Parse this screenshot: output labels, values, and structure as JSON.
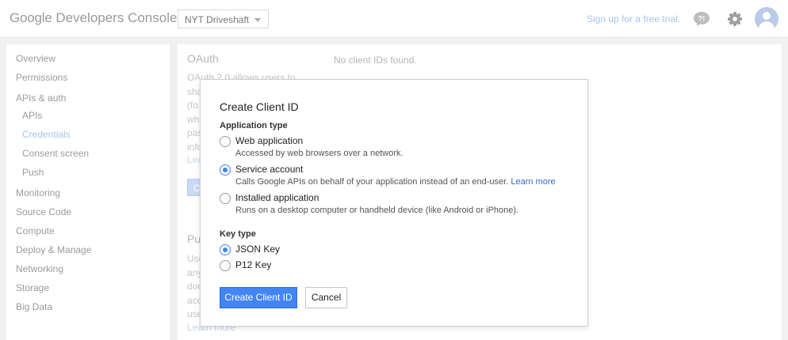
{
  "header": {
    "logo_google": "Google",
    "logo_product": "Developers Console",
    "project": "NYT Driveshaft",
    "signup_link": "Sign up for a free trial.",
    "icons": [
      "feedback-icon",
      "gear-icon",
      "avatar"
    ]
  },
  "sidebar": {
    "items": [
      {
        "label": "Overview"
      },
      {
        "label": "Permissions"
      },
      {
        "label": "APIs & auth"
      },
      {
        "label": "APIs"
      },
      {
        "label": "Credentials"
      },
      {
        "label": "Consent screen"
      },
      {
        "label": "Push"
      },
      {
        "label": "Monitoring"
      },
      {
        "label": "Source Code"
      },
      {
        "label": "Compute"
      },
      {
        "label": "Deploy & Manage"
      },
      {
        "label": "Networking"
      },
      {
        "label": "Storage"
      },
      {
        "label": "Big Data"
      }
    ],
    "active": "Credentials"
  },
  "main": {
    "oauth_title": "OAuth",
    "oauth_text_lines": [
      "OAuth 2.0 allows users to",
      "sha",
      "(fo",
      "whi",
      "pas",
      "info"
    ],
    "oauth_link_fragment": "Lear",
    "oauth_button_fragment": "C",
    "public_title_fragment": "Pu",
    "public_text_lines": [
      "Use",
      "any",
      "doc",
      "acc",
      "use"
    ],
    "public_link": "Learn more",
    "no_clients": "No client IDs found."
  },
  "dialog": {
    "title": "Create Client ID",
    "application_type_label": "Application type",
    "application_types": [
      {
        "label": "Web application",
        "description": "Accessed by web browsers over a network.",
        "checked": false
      },
      {
        "label": "Service account",
        "description": "Calls Google APIs on behalf of your application instead of an end-user.",
        "link": "Learn more",
        "checked": true
      },
      {
        "label": "Installed application",
        "description": "Runs on a desktop computer or handheld device (like Android or iPhone).",
        "checked": false
      }
    ],
    "key_type_label": "Key type",
    "key_types": [
      {
        "label": "JSON Key",
        "checked": true
      },
      {
        "label": "P12 Key",
        "checked": false
      }
    ],
    "create_button": "Create Client ID",
    "cancel_button": "Cancel"
  },
  "colors": {
    "accent": "#4285f4",
    "link": "#3367d6",
    "faded_link": "#a9c3ec"
  }
}
